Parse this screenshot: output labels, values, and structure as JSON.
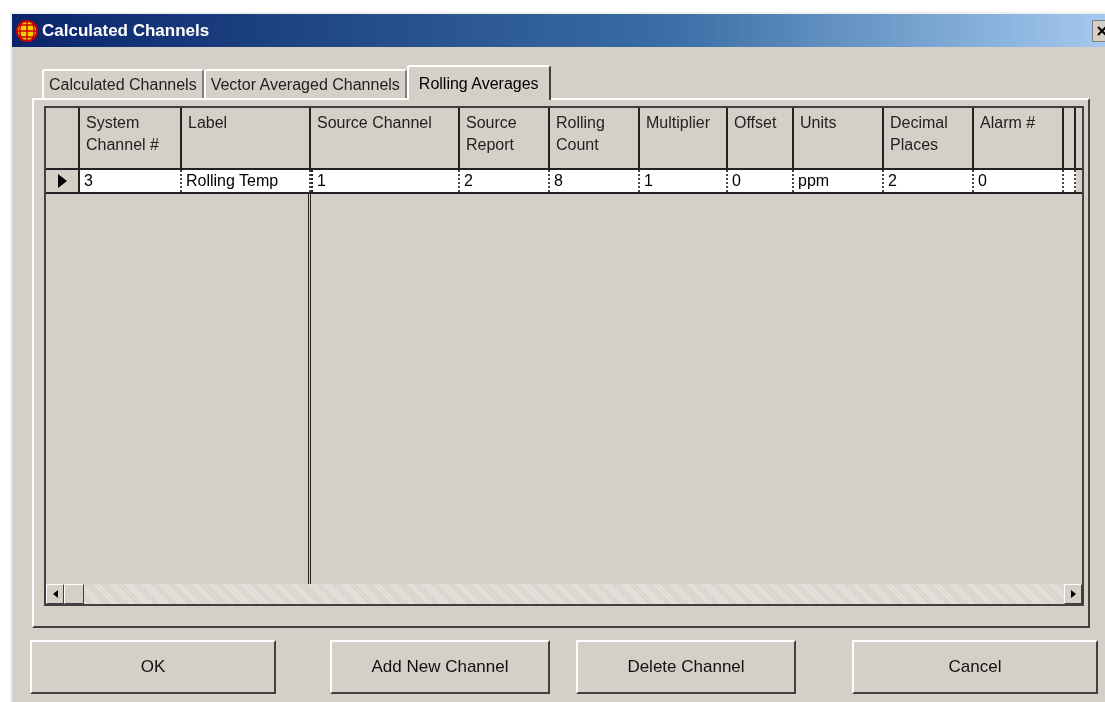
{
  "window": {
    "title": "Calculated Channels"
  },
  "tabs": [
    {
      "label": "Calculated Channels",
      "selected": false
    },
    {
      "label": "Vector Averaged Channels",
      "selected": false
    },
    {
      "label": "Rolling Averages",
      "selected": true
    }
  ],
  "table": {
    "columns": [
      "System Channel #",
      "Label",
      "Source Channel",
      "Source Report",
      "Rolling Count",
      "Multiplier",
      "Offset",
      "Units",
      "Decimal Places",
      "Alarm #"
    ],
    "rows": [
      {
        "current": true,
        "cells": [
          "3",
          "Rolling Temp",
          "1",
          "2",
          "8",
          "1",
          "0",
          "ppm",
          "2",
          "0"
        ]
      }
    ]
  },
  "buttons": [
    "OK",
    "Add New Channel",
    "Delete Channel",
    "Cancel"
  ]
}
